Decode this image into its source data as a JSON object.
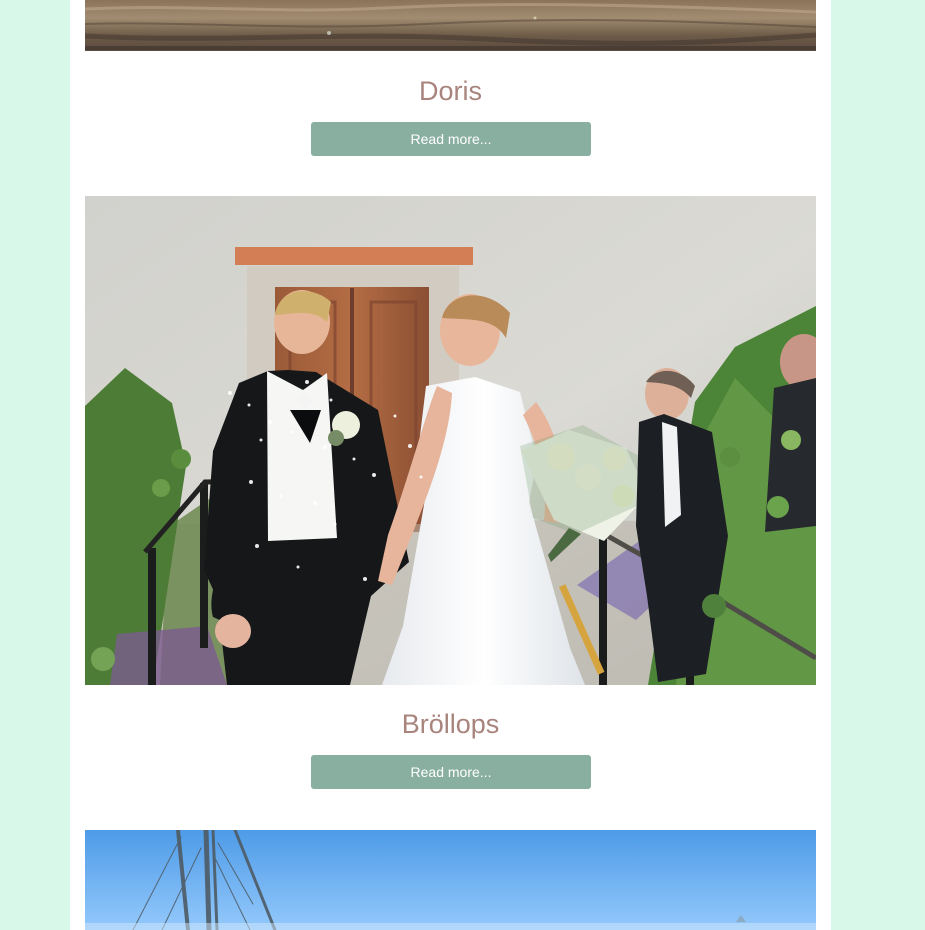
{
  "cards": [
    {
      "title": "Doris",
      "button_label": "Read more...",
      "image_description": "rustic wooden surface"
    },
    {
      "title": "Bröllops",
      "button_label": "Read more...",
      "image_description": "wedding couple walking outdoors"
    },
    {
      "title": "",
      "button_label": "",
      "image_description": "sailing boat masts under blue sky"
    }
  ],
  "colors": {
    "page_background": "#d8f8ea",
    "content_background": "#ffffff",
    "title_color": "#a8847d",
    "button_color": "#89afa1",
    "button_text": "#ffffff"
  }
}
